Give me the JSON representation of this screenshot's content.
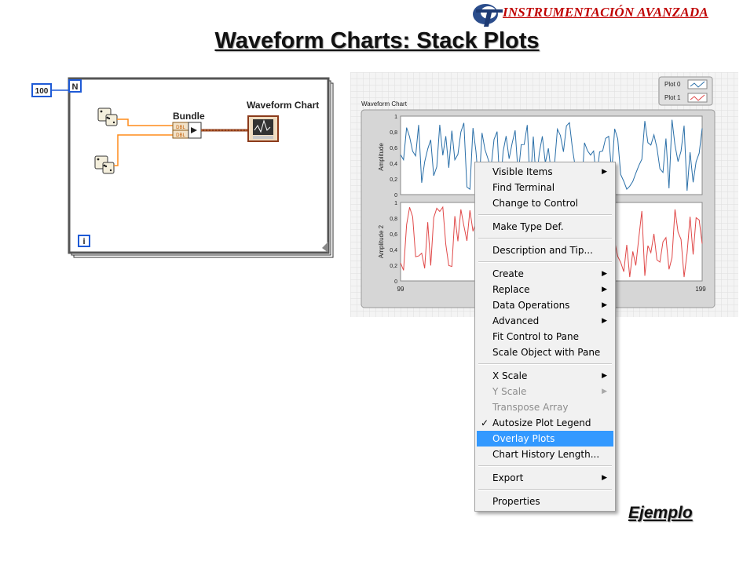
{
  "header": {
    "brand": "INSTRUMENTACIÓN AVANZADA",
    "title": "Waveform Charts: Stack Plots"
  },
  "diagram": {
    "loop_count": "100",
    "count_terminal": "N",
    "iteration_terminal": "i",
    "bundle_label": "Bundle",
    "bundle_input_type": "DBL",
    "chart_label": "Waveform Chart"
  },
  "chart": {
    "title": "Waveform Chart",
    "legend": [
      {
        "name": "Plot 0",
        "color": "#2a6fa8"
      },
      {
        "name": "Plot 1",
        "color": "#e04848"
      }
    ],
    "x_ticks": [
      "99",
      "199"
    ],
    "y_ticks": [
      "0",
      "0,2",
      "0,4",
      "0,6",
      "0,8",
      "1"
    ],
    "plot_top": {
      "ylabel": "Amplitude"
    },
    "plot_bottom": {
      "ylabel": "Amplitude 2"
    }
  },
  "context_menu": {
    "items": [
      {
        "label": "Visible Items",
        "submenu": true
      },
      {
        "label": "Find Terminal"
      },
      {
        "label": "Change to Control"
      },
      {
        "separator": true
      },
      {
        "label": "Make Type Def."
      },
      {
        "separator": true
      },
      {
        "label": "Description and Tip..."
      },
      {
        "separator": true
      },
      {
        "label": "Create",
        "submenu": true
      },
      {
        "label": "Replace",
        "submenu": true
      },
      {
        "label": "Data Operations",
        "submenu": true
      },
      {
        "label": "Advanced",
        "submenu": true
      },
      {
        "label": "Fit Control to Pane"
      },
      {
        "label": "Scale Object with Pane"
      },
      {
        "separator": true
      },
      {
        "label": "X Scale",
        "submenu": true
      },
      {
        "label": "Y Scale",
        "submenu": true,
        "disabled": true
      },
      {
        "label": "Transpose Array",
        "disabled": true
      },
      {
        "label": "Autosize Plot Legend",
        "checked": true
      },
      {
        "label": "Overlay Plots",
        "highlighted": true
      },
      {
        "label": "Chart History Length..."
      },
      {
        "separator": true
      },
      {
        "label": "Export",
        "submenu": true
      },
      {
        "separator": true
      },
      {
        "label": "Properties"
      }
    ]
  },
  "footer": {
    "example_link": "Ejemplo"
  }
}
